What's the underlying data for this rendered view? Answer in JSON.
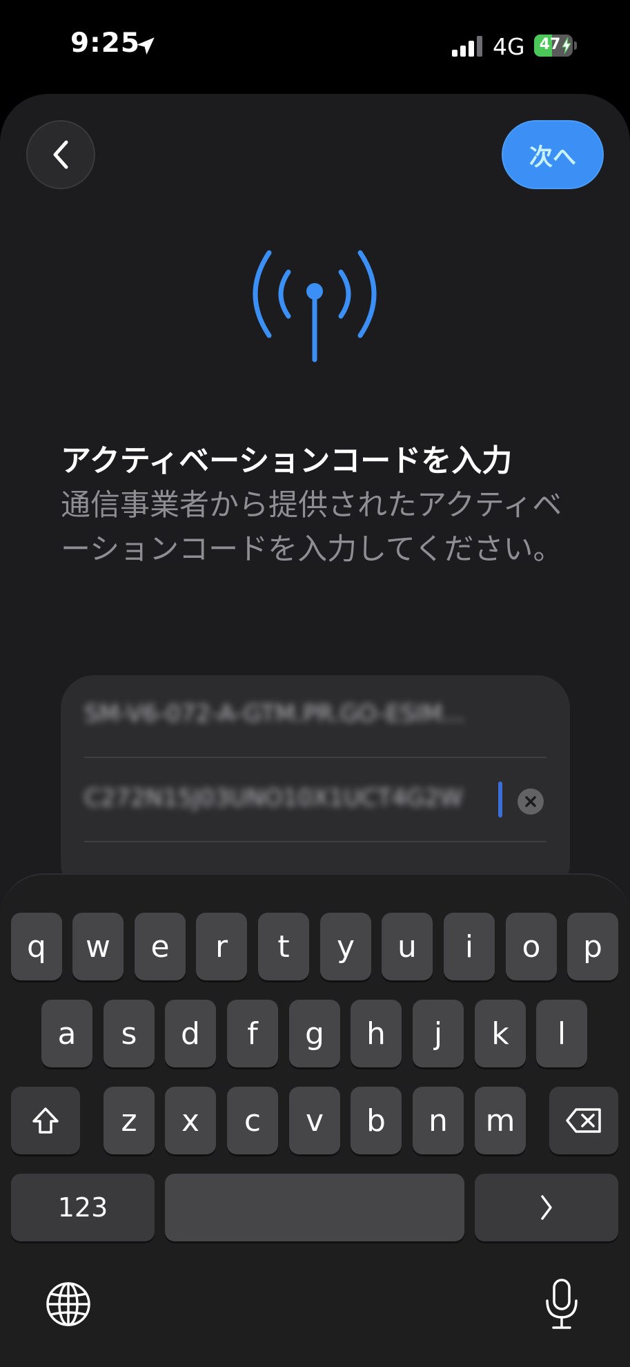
{
  "status_bar": {
    "time": "9:25",
    "network": "4G",
    "battery_level": "47",
    "battery_fraction": 0.47
  },
  "nav": {
    "back_icon": "chevron-left-icon",
    "next_label": "次へ"
  },
  "header": {
    "icon": "antenna-signal-icon",
    "title": "アクティベーションコードを入力",
    "subtitle": "通信事業者から提供されたアクティベーションコードを入力してください。"
  },
  "form": {
    "field1_value": "SM-V6-072-A-GTM.PR.GO-ESIM...",
    "field2_value": "C272N15J03UNO10X1UCT4G2W"
  },
  "keyboard": {
    "row1": [
      "q",
      "w",
      "e",
      "r",
      "t",
      "y",
      "u",
      "i",
      "o",
      "p"
    ],
    "row2": [
      "a",
      "s",
      "d",
      "f",
      "g",
      "h",
      "j",
      "k",
      "l"
    ],
    "row3": [
      "z",
      "x",
      "c",
      "v",
      "b",
      "n",
      "m"
    ],
    "numbers_label": "123",
    "shift_icon": "shift-icon",
    "delete_icon": "delete-icon",
    "return_icon": "chevron-right-icon",
    "globe_icon": "globe-icon",
    "mic_icon": "microphone-icon"
  },
  "colors": {
    "accent": "#3b8ff5",
    "background": "#1c1c1e",
    "key": "#464648"
  }
}
